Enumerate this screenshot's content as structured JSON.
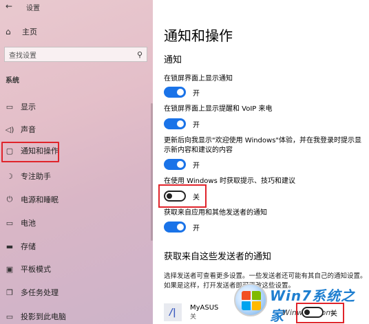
{
  "window": {
    "title": "设置",
    "back_icon": "back-arrow-icon"
  },
  "sidebar": {
    "home_label": "主页",
    "search_placeholder": "查找设置",
    "section_label": "系统",
    "items": [
      {
        "label": "显示",
        "icon": "display-icon",
        "glyph": "▭"
      },
      {
        "label": "声音",
        "icon": "sound-icon",
        "glyph": "🔈"
      },
      {
        "label": "通知和操作",
        "icon": "notification-icon",
        "glyph": "▢",
        "selected": true
      },
      {
        "label": "专注助手",
        "icon": "moon-icon",
        "glyph": "☽"
      },
      {
        "label": "电源和睡眠",
        "icon": "power-icon",
        "glyph": "⏻"
      },
      {
        "label": "电池",
        "icon": "battery-icon",
        "glyph": "▭"
      },
      {
        "label": "存储",
        "icon": "storage-icon",
        "glyph": "▬"
      },
      {
        "label": "平板模式",
        "icon": "tablet-icon",
        "glyph": "▣"
      },
      {
        "label": "多任务处理",
        "icon": "multitask-icon",
        "glyph": "❐"
      },
      {
        "label": "投影到此电脑",
        "icon": "project-icon",
        "glyph": "▭"
      }
    ]
  },
  "main": {
    "title": "通知和操作",
    "notifications_heading": "通知",
    "settings": [
      {
        "label": "在锁屏界面上显示通知",
        "state": "on",
        "state_label": "开"
      },
      {
        "label": "在锁屏界面上显示提醒和 VoIP 来电",
        "state": "on",
        "state_label": "开"
      },
      {
        "label": "更新后向我显示\"欢迎使用 Windows\"体验，并在我登录时提示显示新内容和建议的内容",
        "state": "on",
        "state_label": "开"
      },
      {
        "label": "在使用 Windows 时获取提示、技巧和建议",
        "state": "off",
        "state_label": "关"
      },
      {
        "label": "获取来自应用和其他发送者的通知",
        "state": "on",
        "state_label": "开"
      }
    ],
    "senders_heading": "获取来自这些发送者的通知",
    "senders_desc": "选择发送者可查看更多设置。一些发送者还可能有其自己的通知设置。如果是这样，打开发送者即可更改这些设置。",
    "apps": [
      {
        "name": "MyASUS",
        "status": "关",
        "toggle_label": "关"
      }
    ]
  },
  "watermark": {
    "brand": "Win7系统之家",
    "url": "Winwin7.com"
  },
  "colors": {
    "accent": "#1a73e8",
    "highlight": "#e0232a"
  }
}
